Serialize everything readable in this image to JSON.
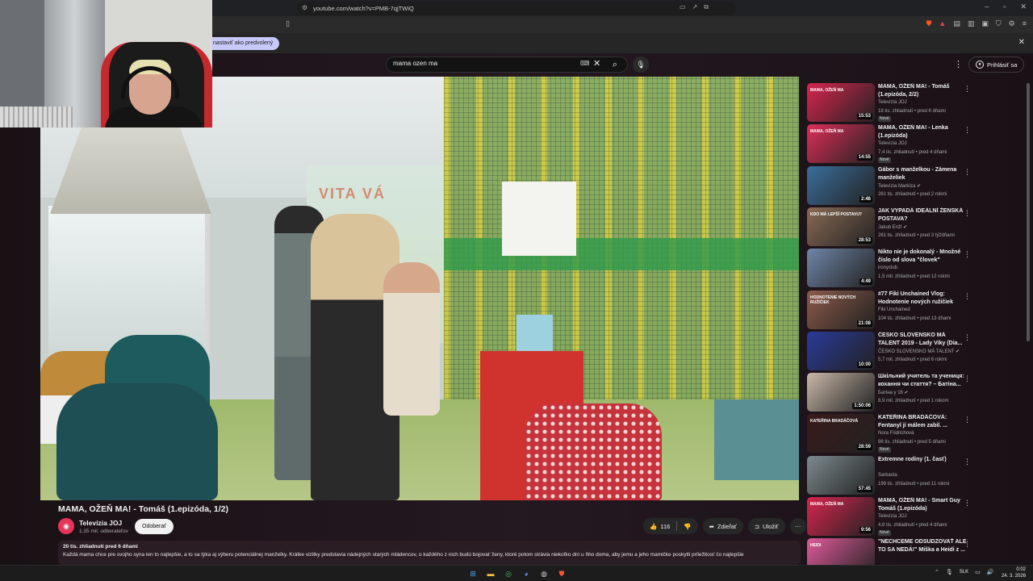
{
  "browser": {
    "url": "youtube.com/watch?v=PMB-7qjTWiQ",
    "infobar_button": "nastaviť ako predvolený",
    "window_controls": [
      "–",
      "▫",
      "✕"
    ]
  },
  "search": {
    "query": "mama ozen ma"
  },
  "header": {
    "signin_label": "Prihlásiť sa"
  },
  "video": {
    "title": "MAMA, OŽEŇ MA! - Tomáš (1.epizóda, 1/2)",
    "mural_text": "VITA VÁ"
  },
  "channel": {
    "name": "Televízia JOJ",
    "subscribers": "1,35 mil. odberateľov",
    "subscribe_label": "Odoberať"
  },
  "actions": {
    "likes": "116",
    "share_label": "Zdieľať",
    "save_label": "Uložiť"
  },
  "description": {
    "meta": "20 tis. zhliadnutí  pred 6 dňami",
    "text": "Každá mama chce pre svojho syna len to najlepšie, a to sa týka aj výberu potenciálnej manželky. Krátke vizitky predstavia nádejných starých mládencov, o každého z nich budú bojovať ženy, ktoré potom strávia niekoľko dní u ňho doma, aby jemu a jeho mamičke poskytli príležitosť čo najlepšie"
  },
  "colors": {
    "joj": "#e73459",
    "brand_red": "#c5282d"
  },
  "recommendations": [
    {
      "title": "MAMA, OŽEŇ MA! - Tomáš (1.epizóda, 2/2)",
      "channel": "Televízia JOJ",
      "meta": "18 tis. zhliadnutí • pred 6 dňami",
      "badge": "Nové",
      "duration": "15:53",
      "tag": "MAMA, OŽEŇ MA",
      "bg": "#d9254f",
      "verified": false
    },
    {
      "title": "MAMA, OŽEŇ MA! - Lenka (1.epizóda)",
      "channel": "Televízia JOJ",
      "meta": "7,4 tis. zhliadnutí • pred 4 dňami",
      "badge": "Nové",
      "duration": "14:55",
      "tag": "MAMA, OŽEŇ MA",
      "bg": "#de2e58",
      "verified": false
    },
    {
      "title": "Gábor s manželkou - Zámena manželiek",
      "channel": "Televízia Markíza",
      "meta": "261 tis. zhliadnutí • pred 2 rokmi",
      "badge": "",
      "duration": "2:46",
      "tag": "",
      "bg": "#3b6e9c",
      "verified": true
    },
    {
      "title": "JAK VYPADÁ IDEÁLNÍ ŽENSKÁ POSTAVA?",
      "channel": "Jakub Enžl",
      "meta": "261 tis. zhliadnutí • pred 3 týždňami",
      "badge": "",
      "duration": "28:53",
      "tag": "KDO MÁ LEPŠÍ POSTAVU?",
      "bg": "#8a6b55",
      "verified": true
    },
    {
      "title": "Nikto nie je dokonalý - Množné číslo od slova \"človek\"",
      "channel": "ironyclub",
      "meta": "1,5 mil. zhliadnutí • pred 12 rokmi",
      "badge": "",
      "duration": "4:49",
      "tag": "",
      "bg": "#6f86a8",
      "verified": false
    },
    {
      "title": "#77 Fiki Unchained Vlog: Hodnotenie nových ružičiek",
      "channel": "Fiki Unchained",
      "meta": "104 tis. zhliadnutí • pred 13 dňami",
      "badge": "",
      "duration": "21:08",
      "tag": "HODNOTENIE NOVÝCH RUŽIČIEK",
      "bg": "#8d5b4a",
      "verified": false
    },
    {
      "title": "ČESKO SLOVENSKO MÁ TALENT 2019 - Lady Viky (Dia...",
      "channel": "ČESKO SLOVENSKO MÁ TALENT",
      "meta": "5,7 mil. zhliadnutí • pred 6 rokmi",
      "badge": "",
      "duration": "10:00",
      "tag": "",
      "bg": "#2a3a9a",
      "verified": true
    },
    {
      "title": "Шкільний учитель та учениця: кохання чи стаття? – Батіна...",
      "channel": "Батіна у 16",
      "meta": "8,9 mil. zhliadnutí • pred 1 rokom",
      "badge": "",
      "duration": "1:50:06",
      "tag": "",
      "bg": "#c9b8a8",
      "verified": true
    },
    {
      "title": "KATEŘINA BRADÁČOVÁ: Fentanyl jí málem zabil. ...",
      "channel": "Nora Fridrichová",
      "meta": "98 tis. zhliadnutí • pred 5 dňami",
      "badge": "Nové",
      "duration": "28:59",
      "tag": "KATEŘINA BRADÁČOVÁ",
      "bg": "#3a1a1a",
      "verified": false
    },
    {
      "title": "Extremne rodiny (1. časť)",
      "channel": "Sarkasta",
      "meta": "199 tis. zhliadnutí • pred 11 rokmi",
      "badge": "",
      "duration": "57:45",
      "tag": "",
      "bg": "#7c8a8e",
      "verified": false
    },
    {
      "title": "MAMA, OŽEŇ MA! - Smart Guy Tomáš (1.epizóda)",
      "channel": "Televízia JOJ",
      "meta": "4,8 tis. zhliadnutí • pred 4 dňami",
      "badge": "Nové",
      "duration": "9:56",
      "tag": "MAMA, OŽEŇ MA",
      "bg": "#d9254f",
      "verified": false
    },
    {
      "title": "\"NECHCEME ODSUDZOVAŤ ALE TO SA NEDÁ!\" Miška a Heidi z ...",
      "channel": "",
      "meta": "",
      "badge": "",
      "duration": "",
      "tag": "HEIDI",
      "bg": "#e05a9a",
      "verified": false
    }
  ],
  "taskbar": {
    "lang": "SLK",
    "time": "0:02",
    "date": "24. 3. 2026"
  }
}
